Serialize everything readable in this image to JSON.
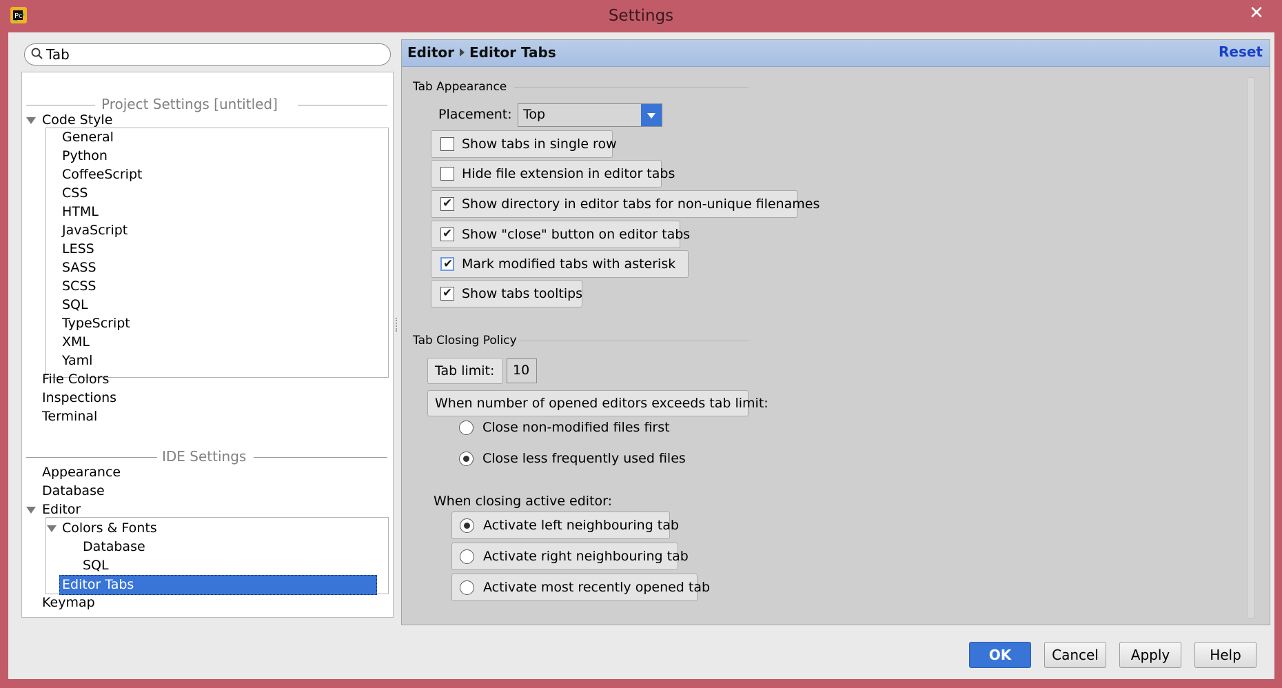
{
  "window": {
    "title": "Settings"
  },
  "search": {
    "value": "Tab",
    "placeholder": ""
  },
  "tree": {
    "project_header": "Project Settings [untitled]",
    "code_style": "Code Style",
    "code_style_children": [
      "General",
      "Python",
      "CoffeeScript",
      "CSS",
      "HTML",
      "JavaScript",
      "LESS",
      "SASS",
      "SCSS",
      "SQL",
      "TypeScript",
      "XML",
      "Yaml"
    ],
    "file_colors": "File Colors",
    "inspections": "Inspections",
    "terminal": "Terminal",
    "ide_header": "IDE Settings",
    "appearance": "Appearance",
    "database": "Database",
    "editor": "Editor",
    "colors_fonts": "Colors & Fonts",
    "cf_database": "Database",
    "cf_sql": "SQL",
    "editor_tabs": "Editor Tabs",
    "keymap": "Keymap"
  },
  "panel": {
    "crumb_1": "Editor",
    "crumb_2": "Editor Tabs",
    "reset": "Reset",
    "appearance_title": "Tab Appearance",
    "placement_label": "Placement:",
    "placement_value": "Top",
    "checkboxes": [
      {
        "label": "Show tabs in single row",
        "checked": false
      },
      {
        "label": "Hide file extension in editor tabs",
        "checked": false
      },
      {
        "label": "Show directory in editor tabs for non-unique filenames",
        "checked": true
      },
      {
        "label": "Show \"close\" button on editor tabs",
        "checked": true
      },
      {
        "label": "Mark modified tabs with asterisk",
        "checked": true
      },
      {
        "label": "Show tabs tooltips",
        "checked": true
      }
    ],
    "closing_title": "Tab Closing Policy",
    "tab_limit_label": "Tab limit:",
    "tab_limit_value": "10",
    "exceeds_label": "When number of opened editors exceeds tab limit:",
    "close_non_modified": "Close non-modified files first",
    "close_less_frequent": "Close less frequently used files",
    "closing_active_label": "When closing active editor:",
    "activate_left": "Activate left neighbouring tab",
    "activate_right": "Activate right neighbouring tab",
    "activate_recent": "Activate most recently opened tab"
  },
  "buttons": {
    "ok": "OK",
    "cancel": "Cancel",
    "apply": "Apply",
    "help": "Help"
  }
}
